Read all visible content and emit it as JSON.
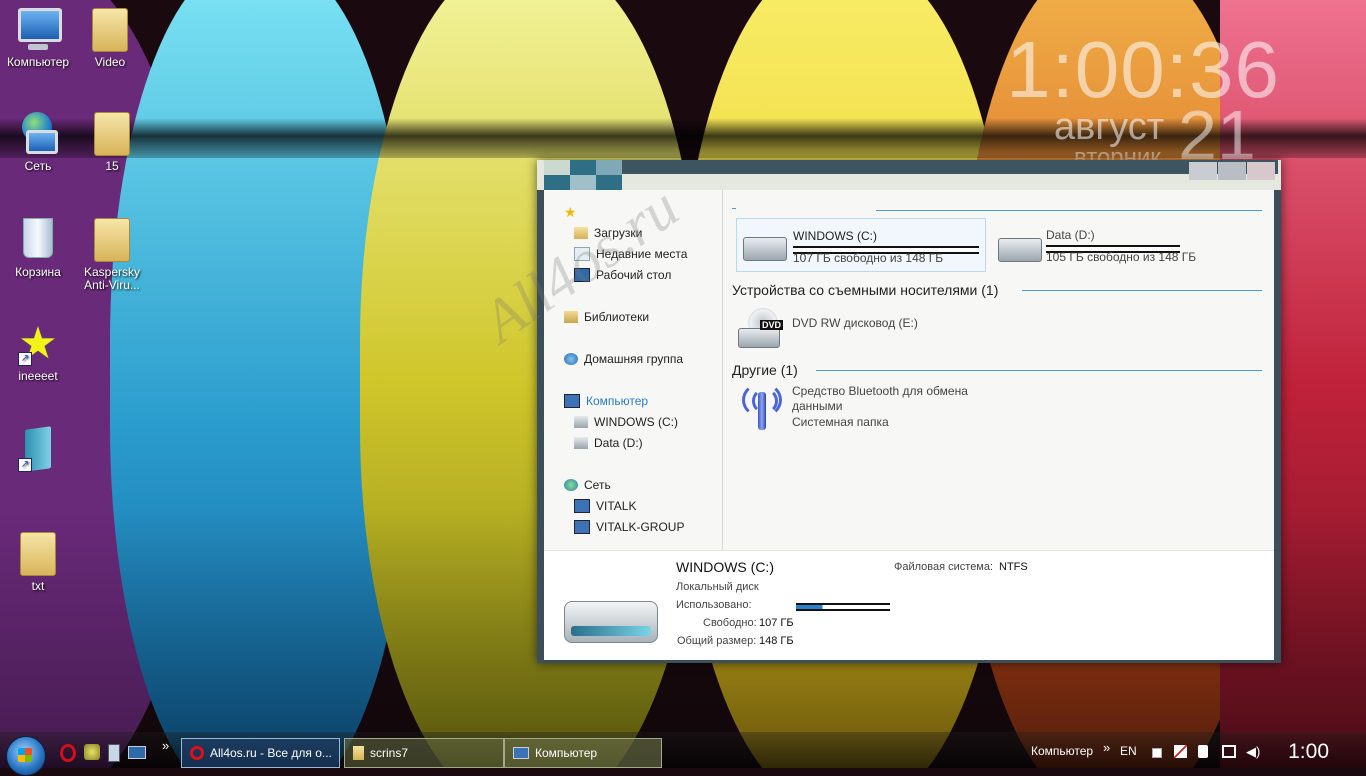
{
  "desktop": {
    "icons": [
      {
        "label": "Компьютер",
        "icon": "computer-icon"
      },
      {
        "label": "Video",
        "icon": "folder-icon"
      },
      {
        "label": "Сеть",
        "icon": "network-icon"
      },
      {
        "label": "15",
        "icon": "folder-icon"
      },
      {
        "label": "Корзина",
        "icon": "recycle-bin-icon"
      },
      {
        "label": "Kaspersky Anti-Viru...",
        "icon": "folder-icon"
      },
      {
        "label": "ineeeet",
        "icon": "star-shortcut-icon"
      },
      {
        "label": "",
        "icon": "book-shortcut-icon"
      },
      {
        "label": "txt",
        "icon": "folder-icon"
      }
    ]
  },
  "clock_widget": {
    "time": "1:00:36",
    "month": "август",
    "day": "21",
    "weekday": "вторник"
  },
  "watermark": "All4os.ru",
  "explorer": {
    "nav": {
      "favorites": [
        {
          "label": "Загрузки",
          "icon": "downloads-icon"
        },
        {
          "label": "Недавние места",
          "icon": "recent-places-icon"
        },
        {
          "label": "Рабочий стол",
          "icon": "desktop-icon"
        }
      ],
      "libraries": "Библиотеки",
      "homegroup": "Домашняя группа",
      "computer": "Компьютер",
      "computer_children": [
        "WINDOWS (C:)",
        "Data (D:)"
      ],
      "network": "Сеть",
      "network_children": [
        "VITALK",
        "VITALK-GROUP"
      ]
    },
    "drives": [
      {
        "name": "WINDOWS (C:)",
        "free": "107 ГБ свободно из 148 ГБ"
      },
      {
        "name": "Data (D:)",
        "free": "105 ГБ свободно из 148 ГБ"
      }
    ],
    "removable_header": "Устройства со съемными носителями (1)",
    "removable": {
      "name": "DVD RW дисковод (E:)",
      "badge": "DVD"
    },
    "other_header": "Другие (1)",
    "other": {
      "name_line1": "Средство Bluetooth для обмена",
      "name_line2": "данными",
      "type": "Системная папка"
    },
    "details": {
      "title": "WINDOWS (C:)",
      "subtitle": "Локальный диск",
      "used_label": "Использовано:",
      "free_label": "Свободно:",
      "free_value": "107 ГБ",
      "total_label": "Общий размер:",
      "total_value": "148 ГБ",
      "fs_label": "Файловая система:",
      "fs_value": "NTFS",
      "used_fraction": 0.28
    }
  },
  "taskbar": {
    "buttons": [
      {
        "label": "All4os.ru - Все для о...",
        "icon": "opera-icon"
      },
      {
        "label": "scrins7",
        "icon": "folder-icon"
      },
      {
        "label": "Компьютер",
        "icon": "computer-icon"
      }
    ],
    "overflow": "»",
    "toolbar_label": "Компьютер",
    "language": "EN",
    "clock": "1:00"
  }
}
